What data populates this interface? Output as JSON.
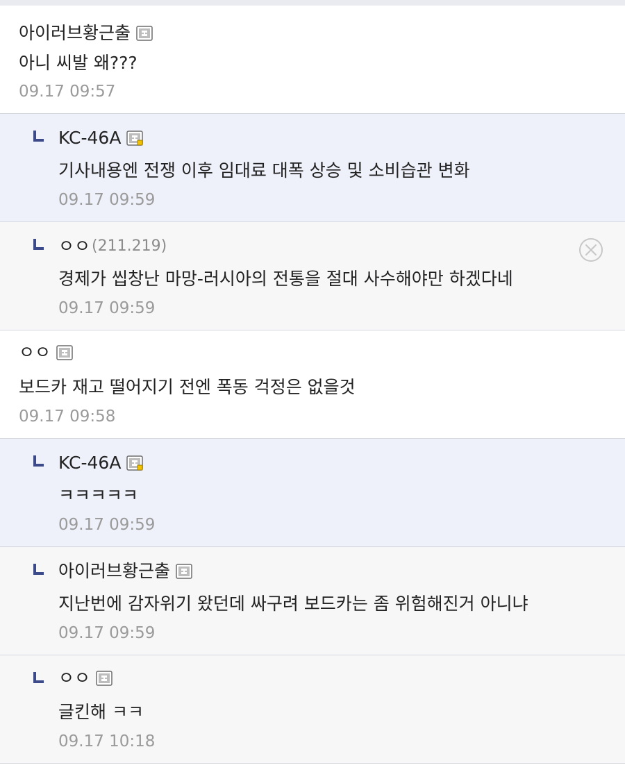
{
  "comments": [
    {
      "author": "아이러브황근출",
      "badge": "fixed-nick-icon",
      "text": "아니 씨발 왜???",
      "time": "09.17 09:57"
    },
    {
      "author": "KC-46A",
      "badge": "fixed-nick-manager-icon",
      "text": "기사내용엔 전쟁 이후 임대료 대폭 상승 및 소비습관 변화",
      "time": "09.17 09:59"
    },
    {
      "author": "ㅇㅇ",
      "ip": "(211.219)",
      "text": "경제가 씹창난 마망-러시아의 전통을 절대 사수해야만 하겠다네",
      "time": "09.17 09:59"
    },
    {
      "author": "ㅇㅇ",
      "badge": "fixed-nick-icon",
      "text": "보드카 재고 떨어지기 전엔 폭동 걱정은 없을것",
      "time": "09.17 09:58"
    },
    {
      "author": "KC-46A",
      "badge": "fixed-nick-manager-icon",
      "text": "ㅋㅋㅋㅋㅋ",
      "time": "09.17 09:59"
    },
    {
      "author": "아이러브황근출",
      "badge": "fixed-nick-icon",
      "text": "지난번에 감자위기 왔던데 싸구려 보드카는 좀 위험해진거 아니냐",
      "time": "09.17 09:59"
    },
    {
      "author": "ㅇㅇ",
      "badge": "fixed-nick-icon",
      "text": "글킨해 ㅋㅋ",
      "time": "09.17 10:18"
    }
  ],
  "icons": {
    "reply_arrow": "reply-arrow-icon",
    "delete": "delete-circle-x-icon"
  },
  "colors": {
    "reply_arrow": "#3d4a8a",
    "highlight_bg": "#eef1fa",
    "reply_bg": "#f7f7f8",
    "timestamp": "#9a9a9a",
    "ip": "#8c8c8c",
    "badge_dot": "#f2c200"
  }
}
